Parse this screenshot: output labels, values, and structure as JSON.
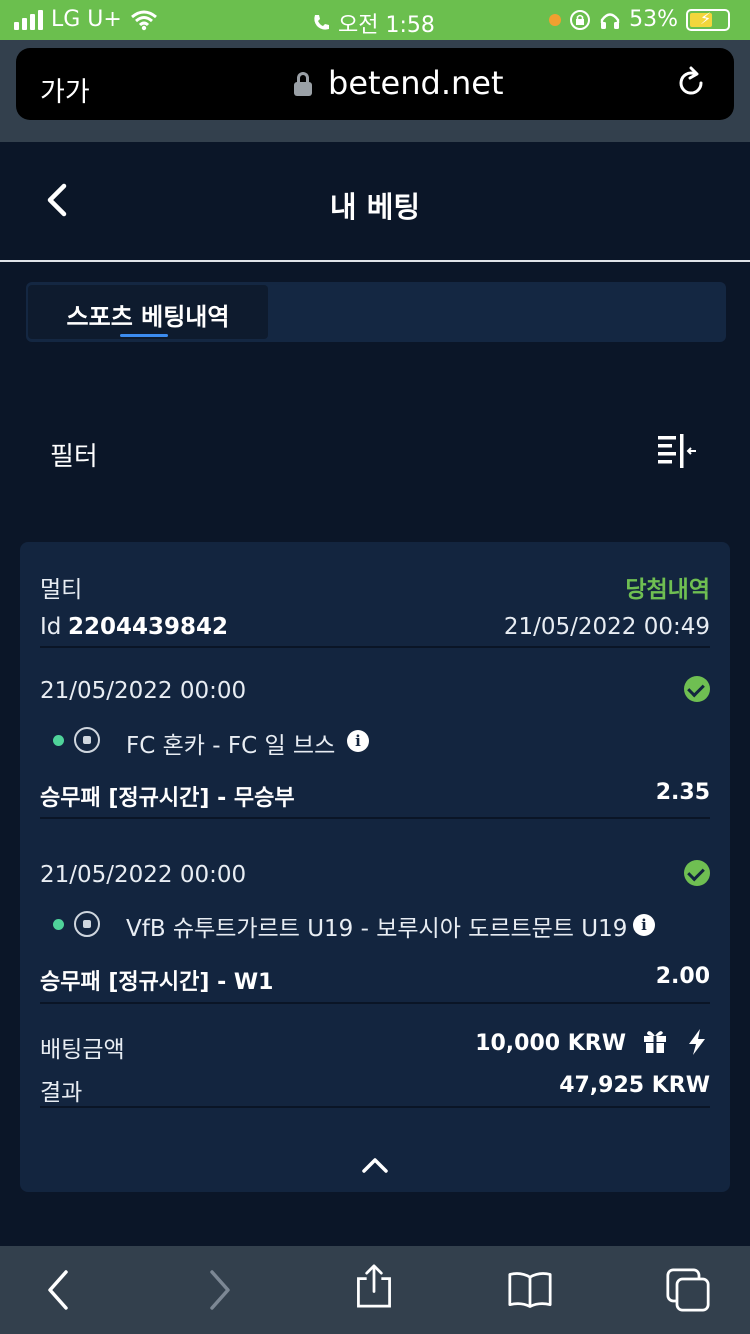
{
  "status_bar": {
    "carrier": "LG U+",
    "time": "오전 1:58",
    "battery_percent": "53%",
    "background_color": "#6bbf4e"
  },
  "browser": {
    "text_size_label": "가가",
    "url": "betend.net",
    "icons": [
      "lock-icon",
      "reload-icon"
    ]
  },
  "header": {
    "title": "내 베팅",
    "back_icon": "chevron-left-icon"
  },
  "tabs": [
    {
      "label": "스포츠 베팅내역",
      "active": true
    }
  ],
  "filter": {
    "label": "필터",
    "icon": "filter-collapse-icon"
  },
  "bet": {
    "type": "멀티",
    "status": "당첨내역",
    "id_label": "Id",
    "id_value": "2204439842",
    "placed_at": "21/05/2022 00:49",
    "selections": [
      {
        "datetime": "21/05/2022 00:00",
        "match": "FC 혼카 - FC 일 브스",
        "market": "승무패 [정규시간] - 무승부",
        "odds": "2.35",
        "won": true
      },
      {
        "datetime": "21/05/2022 00:00",
        "match": "VfB 슈투트가르트 U19 - 보루시아 도르트문트 U19",
        "market": "승무패 [정규시간] - W1",
        "odds": "2.00",
        "won": true
      }
    ],
    "stake_label": "배팅금액",
    "stake_value": "10,000 KRW",
    "result_label": "결과",
    "result_value": "47,925 KRW"
  },
  "colors": {
    "background": "#0b1628",
    "card": "#13253f",
    "won_green": "#6fbf52",
    "tab_accent": "#3c8cf0"
  }
}
